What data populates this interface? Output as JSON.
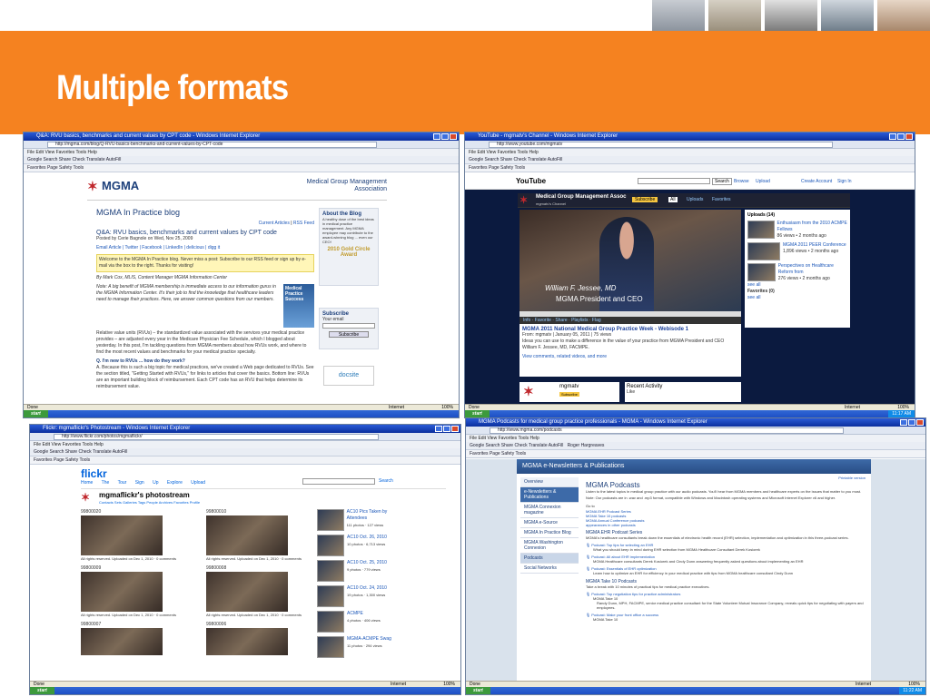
{
  "slide": {
    "title": "Multiple formats"
  },
  "colors": {
    "accent": "#f58220",
    "ie_title": "#0a2f9d",
    "mgma_blue": "#1c3f7a"
  },
  "win1": {
    "title": "Q&A: RVU basics, benchmarks and current values by CPT code - Windows Internet Explorer",
    "address": "http://mgma.com/blog/Q-RVU-basics-benchmarks-and-current-values-by-CPT-code",
    "menu": "File   Edit   View   Favorites   Tools   Help",
    "toolbar": "Google   Search   Share   Check   Translate   AutoFill",
    "favorites": "Favorites   Page   Safety   Tools",
    "logo": "MGMA",
    "org_name": "Medical Group Management Association",
    "blog_title": "MGMA In Practice blog",
    "current_articles": "Current Articles",
    "rss_feed": "RSS Feed",
    "post_title": "Q&A: RVU basics, benchmarks and current values by CPT code",
    "posted_by": "Posted by Cerie Bagnole on Wed, Nov 25, 2009",
    "share_links": "Email Article | Twitter | Facebook | LinkedIn | delicious | digg it",
    "welcome": "Welcome to the MGMA In Practice blog. Never miss a post: Subscribe to our RSS feed or sign up by e-mail via the box to the right. Thanks for visiting!",
    "byline": "By Mark Cox, MLIS, Content Manager MGMA Information Center",
    "body1": "Note: A big benefit of MGMA membership is immediate access to our information gurus in the MGMA Information Center. It's their job to find the knowledge that healthcare leaders need to manage their practices. Here, we answer common questions from our members.",
    "body2": "Relative value units (RVUs) – the standardized value associated with the services your medical practice provides – are adjusted every year in the Medicare Physician Fee Schedule, which I blogged about yesterday. In this post, I'm tackling questions from MGMA members about how RVUs work, and where to find the most recent values and benchmarks for your medical practice specialty.",
    "question": "Q. I'm new to RVUs ... how do they work?",
    "answer": "A. Because this is such a big topic for medical practices, we've created a Web page dedicated to RVUs. See the section titled, \"Getting Started with RVUs,\" for links to articles that cover the basics. Bottom line: RVUs are an important building block of reimbursement. Each CPT code has an RVU that helps determine its reimbursement value.",
    "about_title": "About the Blog",
    "about_text": "A healthy dose of the best ideas in medical practice management. Any MGMA employee may contribute to the award-winning blog ... even our CEO!",
    "award": "2010 Gold Circle Award",
    "subscribe_title": "Subscribe",
    "your_email": "Your email",
    "subscribe_btn": "Subscribe",
    "book_title": "Medical Practice Success",
    "docsite": "docsite",
    "status": "Done",
    "zone": "Internet",
    "zoom": "100%",
    "start": "start"
  },
  "win2": {
    "title": "YouTube - mgmatv's Channel - Windows Internet Explorer",
    "address": "http://www.youtube.com/mgmatv",
    "logo": "YouTube",
    "search_btn": "Search",
    "browse": "Browse",
    "upload": "Upload",
    "create_account": "Create Account",
    "sign_in": "Sign In",
    "channel_name": "Medical Group Management Assoc",
    "channel_sub": "mgmatv's Channel",
    "subscribe": "Subscribe",
    "tabs": [
      "All",
      "Uploads",
      "Favorites"
    ],
    "caption_name": "William F. Jessee, MD",
    "caption_role": "MGMA President and CEO",
    "info_tabs": [
      "Info",
      "Favorite",
      "Share",
      "Playlists",
      "Flag"
    ],
    "video_title": "MGMA 2011 National Medical Group Practice Week - Webisode 1",
    "video_meta": "From: mgmatv | January 05, 2011 | 75 views",
    "video_desc": "Ideas you can use to make a difference in the value of your practice from MGMA President and CEO William F. Jessee, MD, FACMPE.",
    "view_comments": "View comments, related videos, and more",
    "uploads_label": "Uploads (14)",
    "uploads": [
      {
        "title": "Enthusiasm from the 2010 ACMPE Fellows",
        "meta": "86 views • 2 months ago"
      },
      {
        "title": "MGMA 2011 PEER Conference",
        "meta": "1,896 views • 2 months ago"
      },
      {
        "title": "Perspectives on Healthcare Reform from",
        "meta": "276 views • 2 months ago"
      }
    ],
    "see_all": "see all",
    "favorites_label": "Favorites (0)",
    "user_name": "mgmatv",
    "recent_activity": "Recent Activity",
    "like": "Like",
    "time": "11:17 AM"
  },
  "win3": {
    "title": "Flickr: mgmaflickr's Photostream - Windows Internet Explorer",
    "address": "http://www.flickr.com/photos/mgmaflickr/",
    "logo": "flickr",
    "nav": [
      "Home",
      "The Tour",
      "Sign Up",
      "Explore",
      "Upload"
    ],
    "search_btn": "Search",
    "heading": "mgmaflickr's photostream",
    "subnav": "Contacts  Sets  Galleries  Tags  People  Archives  Favorites  Profile",
    "photos": [
      {
        "id": "99800020",
        "caption": "All rights reserved. Uploaded on Dec 1, 2010 · 0 comments"
      },
      {
        "id": "99800010",
        "caption": "All rights reserved. Uploaded on Dec 1, 2010 · 0 comments"
      },
      {
        "id": "99800009",
        "caption": "All rights reserved. Uploaded on Dec 1, 2010 · 0 comments"
      },
      {
        "id": "99800008",
        "caption": "All rights reserved. Uploaded on Dec 1, 2010 · 0 comments"
      },
      {
        "id": "99800007",
        "caption": ""
      },
      {
        "id": "99800006",
        "caption": ""
      }
    ],
    "sets": [
      {
        "title": "AC10 Pics Taken by Attendees",
        "meta": "111 photos · 127 views"
      },
      {
        "title": "AC10 Oct. 26, 2010",
        "meta": "10 photos · 6,713 views"
      },
      {
        "title": "AC10 Oct. 25, 2010",
        "meta": "9 photos · 779 views"
      },
      {
        "title": "AC10 Oct. 24, 2010",
        "meta": "19 photos · 1,300 views"
      },
      {
        "title": "ACMPE",
        "meta": "4 photos · 406 views"
      },
      {
        "title": "MGMA-ACMPE Swag",
        "meta": "11 photos · 294 views"
      }
    ]
  },
  "win4": {
    "title": "MGMA Podcasts for medical group practice professionals - MGMA - Windows Internet Explorer",
    "address": "http://www.mgma.com/podcasts",
    "section": "MGMA e-Newsletters & Publications",
    "printable": "Printable version",
    "side_nav": [
      "Overview",
      "e-Newsletters & Publications",
      "MGMA Connexion magazine",
      "MGMA e-Source",
      "MGMA In Practice Blog",
      "MGMA Washington Connexion",
      "Podcasts",
      "Social Networks"
    ],
    "page_title": "MGMA Podcasts",
    "intro": "Listen to the latest topics in medical group practice with our audio podcasts. You'll hear from MGMA members and healthcare experts on the issues that matter to you most.",
    "note": "Note: Our podcasts are in .wav and .mp3 format, compatible with Windows and Macintosh operating systems and Microsoft Internet Explorer v6 and higher.",
    "goto": "Go to",
    "goto_links": [
      "MGMA EHR Podcast Series",
      "MGMA Take 10 podcasts",
      "MGMA Annual Conference podcasts",
      "appearances in other podcasts"
    ],
    "series1_title": "MGMA EHR Podcast Series",
    "series1_desc": "MGMA's healthcare consultants break down the essentials of electronic health record (EHR) selection, implementation and optimization in this three-podcast series.",
    "episodes": [
      {
        "title": "Podcast: Top tips for selecting an EHR",
        "desc": "What you should keep in mind during EHR selection from MGMA Healthcare Consultant Derek Kosiorek"
      },
      {
        "title": "Podcast: All about EHR implementation",
        "desc": "MGMA Healthcare consultants Derek Kosiorek and Cindy Dunn answering frequently asked questions about implementing an EHR"
      },
      {
        "title": "Podcast: Essentials of EHR optimization",
        "desc": "Learn how to optimize an EHR for efficiency in your medical practice with tips from MGMA healthcare consultant Cindy Dunn"
      }
    ],
    "series2_title": "MGMA Take 10 Podcasts",
    "series2_desc": "Take a break with 10 minutes of practical tips for medical practice executives.",
    "episode4_title": "Podcast: Top negotiation tips for practice administrators",
    "episode4_sub": "MGMA Take 10",
    "episode4_desc": "Randy Dunn, MPH, FACMPE, senior medical practice consultant for the State Volunteer Mutual Insurance Company, reveals quick tips for negotiating with payers and employees.",
    "episode5_title": "Podcast: Make your front office a success",
    "episode5_sub": "MGMA Take 10",
    "user": "Roger Hargreaves",
    "time": "11:22 AM"
  }
}
